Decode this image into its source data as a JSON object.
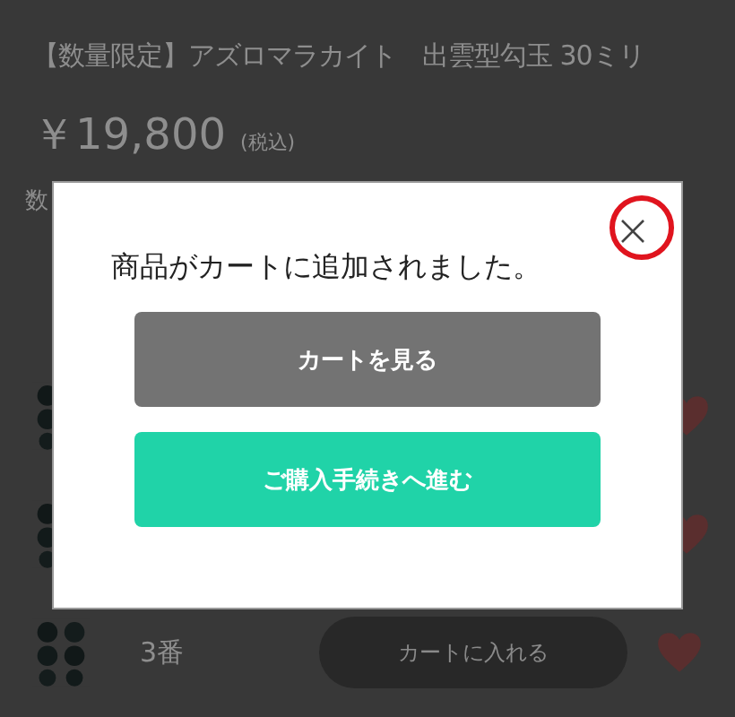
{
  "product": {
    "title": "【数量限定】アズロマラカイト　出雲型勾玉 30ミリ",
    "price": "￥19,800",
    "tax_note": "(税込)",
    "quantity_label": "数"
  },
  "variants": [
    {
      "kind": "covered"
    },
    {
      "kind": "covered"
    },
    {
      "kind": "full",
      "label": "3番",
      "button": "カートに入れる"
    }
  ],
  "modal": {
    "message": "商品がカートに追加されました。",
    "buttons": [
      {
        "label": "カートを見る",
        "kind": "secondary"
      },
      {
        "label": "ご購入手続きへ進む",
        "kind": "primary"
      }
    ],
    "close_highlighted": true
  }
}
